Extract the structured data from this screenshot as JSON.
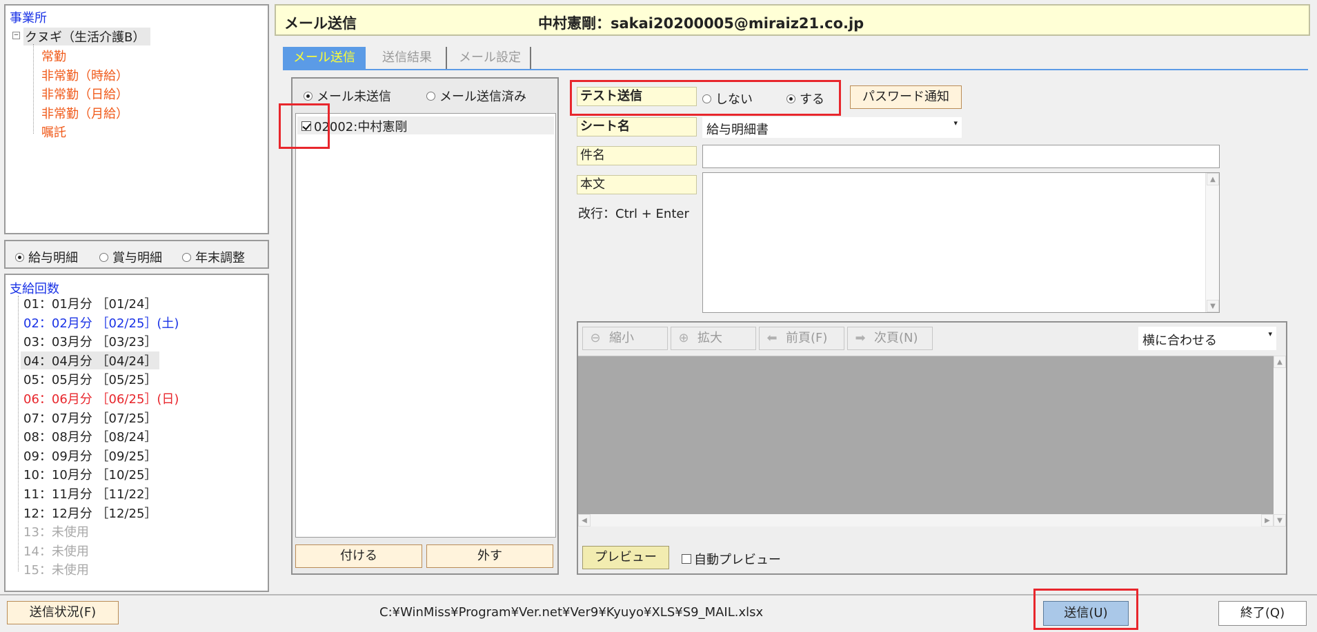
{
  "office_tree": {
    "header": "事業所",
    "root": "クヌギ（生活介護B）",
    "children": [
      "常勤",
      "非常勤（時給）",
      "非常勤（日給）",
      "非常勤（月給）",
      "嘱託"
    ]
  },
  "statement_type": {
    "options": [
      "給与明細",
      "賞与明細",
      "年末調整"
    ],
    "selected": "給与明細"
  },
  "pay_periods": {
    "header": "支給回数",
    "items": [
      {
        "text": "01：01月分 ［01/24］",
        "style": "normal"
      },
      {
        "text": "02：02月分 ［02/25］(土)",
        "style": "blue"
      },
      {
        "text": "03：03月分 ［03/23］",
        "style": "normal"
      },
      {
        "text": "04：04月分 ［04/24］",
        "style": "selected"
      },
      {
        "text": "05：05月分 ［05/25］",
        "style": "normal"
      },
      {
        "text": "06：06月分 ［06/25］(日)",
        "style": "red"
      },
      {
        "text": "07：07月分 ［07/25］",
        "style": "normal"
      },
      {
        "text": "08：08月分 ［08/24］",
        "style": "normal"
      },
      {
        "text": "09：09月分 ［09/25］",
        "style": "normal"
      },
      {
        "text": "10：10月分 ［10/25］",
        "style": "normal"
      },
      {
        "text": "11：11月分 ［11/22］",
        "style": "normal"
      },
      {
        "text": "12：12月分 ［12/25］",
        "style": "normal"
      },
      {
        "text": "13：未使用",
        "style": "gray"
      },
      {
        "text": "14：未使用",
        "style": "gray"
      },
      {
        "text": "15：未使用",
        "style": "gray"
      }
    ]
  },
  "header": {
    "title": "メール送信",
    "recipient": "中村憲剛：sakai20200005@miraiz21.co.jp"
  },
  "tabs": [
    "メール送信",
    "送信結果",
    "メール設定"
  ],
  "active_tab": "メール送信",
  "recipient_list": {
    "filter_options": [
      "メール未送信",
      "メール送信済み"
    ],
    "selected_filter": "メール未送信",
    "items": [
      {
        "label": "02002:中村憲剛",
        "checked": true
      }
    ],
    "attach_button": "付ける",
    "detach_button": "外す"
  },
  "form": {
    "test_send_label": "テスト送信",
    "test_send_options": [
      "しない",
      "する"
    ],
    "test_send_selected": "する",
    "password_button": "パスワード通知",
    "sheet_label": "シート名",
    "sheet_value": "給与明細書",
    "subject_label": "件名",
    "subject_value": "",
    "body_label": "本文",
    "body_value": "",
    "newline_hint": "改行：Ctrl + Enter"
  },
  "preview": {
    "zoom_out": "縮小",
    "zoom_in": "拡大",
    "prev_page": "前頁(F)",
    "next_page": "次頁(N)",
    "fit_mode": "横に合わせる",
    "preview_button": "プレビュー",
    "auto_preview_label": "自動プレビュー",
    "auto_preview_checked": false
  },
  "footer": {
    "status_button": "送信状況(F)",
    "file_path": "C:¥WinMiss¥Program¥Ver.net¥Ver9¥Kyuyo¥XLS¥S9_MAIL.xlsx",
    "send_button": "送信(U)",
    "exit_button": "終了(Q)"
  },
  "colors": {
    "header_bg": "#ffffd6",
    "active_tab_bg": "#5b9be6",
    "label_bg": "#fffcd6",
    "button_bg": "#fff3dc",
    "highlight_red": "#e8262c",
    "tree_orange": "#f05a1a",
    "link_blue": "#1a33e6",
    "preview_canvas": "#a8a8a8"
  }
}
